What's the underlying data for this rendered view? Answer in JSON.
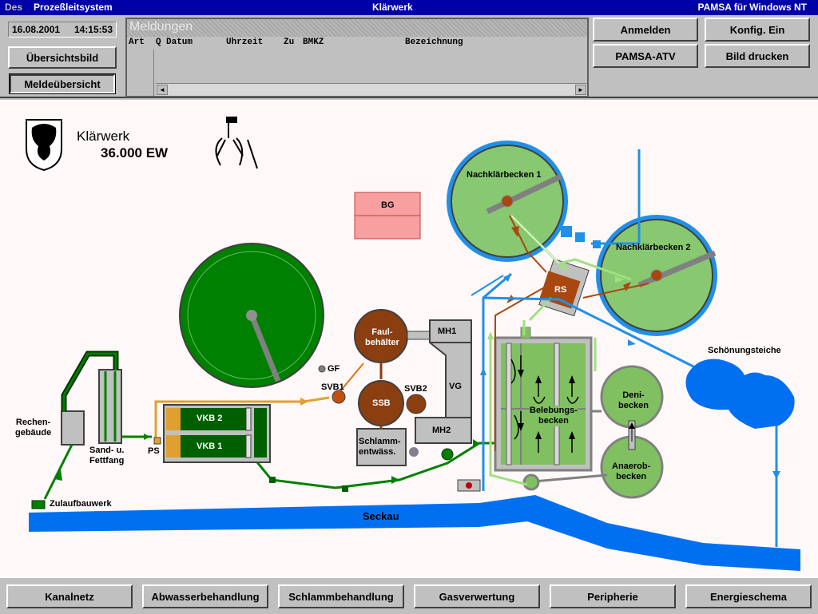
{
  "titlebar": {
    "menu": "Des",
    "system": "Prozeßleitsystem",
    "title": "Klärwerk",
    "product": "PAMSA für Windows NT"
  },
  "status": {
    "date": "16.08.2001",
    "time": "14:15:53"
  },
  "nav_buttons": {
    "overview": "Übersichtsbild",
    "messages": "Meldeübersicht"
  },
  "meldungen": {
    "title": "Meldungen",
    "columns": [
      "Art",
      "Q",
      "Datum",
      "Uhrzeit",
      "Zu",
      "BMKZ",
      "Bezeichnung"
    ]
  },
  "top_right_buttons": {
    "login": "Anmelden",
    "config": "Konfig. Ein",
    "atv": "PAMSA-ATV",
    "print": "Bild drucken"
  },
  "plant": {
    "name": "Klärwerk",
    "capacity": "36.000 EW",
    "bg": "BG",
    "nachklaer1": "Nachklärbecken 1",
    "nachklaer2": "Nachklärbecken 2",
    "rs": "RS",
    "faul": "Faul-\nbehälter",
    "mh1": "MH1",
    "mh2": "MH2",
    "vg": "VG",
    "gf": "GF",
    "svb1": "SVB1",
    "svb2": "SVB2",
    "ssb": "SSB",
    "schlamm": "Schlamm-\nentwäss.",
    "vkb2": "VKB 2",
    "vkb1": "VKB 1",
    "ps": "PS",
    "rechen": "Rechen-\ngebäude",
    "sand": "Sand- u.\nFettfang",
    "zulauf": "Zulaufbauwerk",
    "belebung": "Belebungs-\nbecken",
    "deni": "Deni-\nbecken",
    "anaerob": "Anaerob-\nbecken",
    "schoenung": "Schönungsteiche",
    "seckau": "Seckau"
  },
  "bottom_nav": [
    "Kanalnetz",
    "Abwasserbehandlung",
    "Schlammbehandlung",
    "Gasverwertung",
    "Peripherie",
    "Energieschema"
  ],
  "colors": {
    "water": "#0070f0",
    "sludge": "#a84810",
    "green_basin": "#80c060",
    "dark_green": "#007000",
    "orange_line": "#e0a030",
    "grey_unit": "#c0c0c0",
    "bg_box": "#f8a0a0"
  }
}
